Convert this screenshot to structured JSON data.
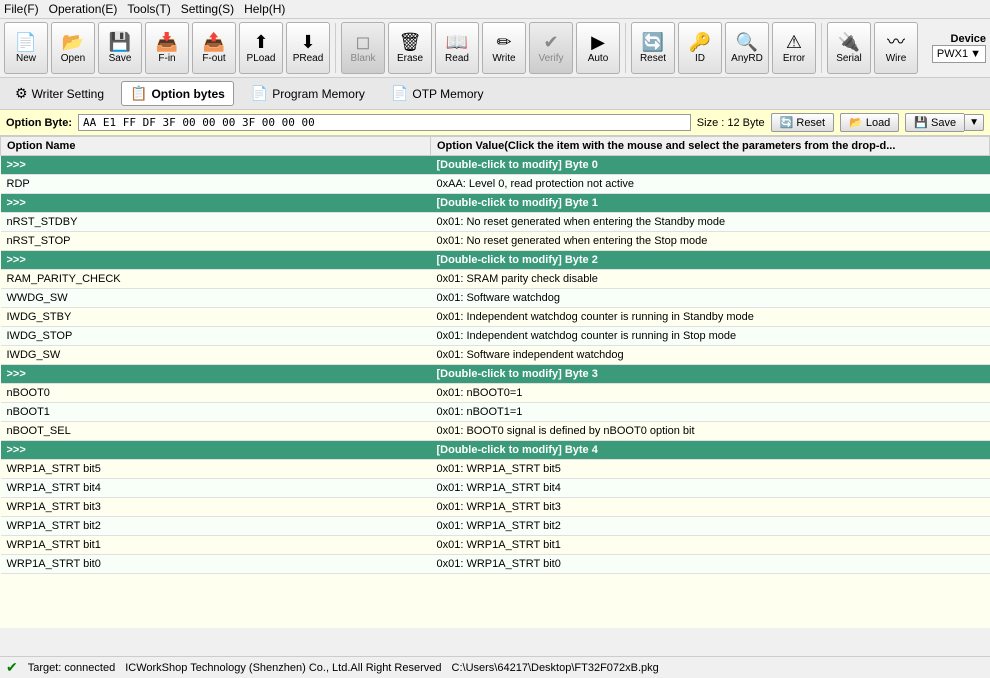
{
  "menubar": {
    "items": [
      {
        "label": "File(F)",
        "name": "menu-file"
      },
      {
        "label": "Operation(E)",
        "name": "menu-operation"
      },
      {
        "label": "Tools(T)",
        "name": "menu-tools"
      },
      {
        "label": "Setting(S)",
        "name": "menu-setting"
      },
      {
        "label": "Help(H)",
        "name": "menu-help"
      }
    ]
  },
  "toolbar": {
    "buttons": [
      {
        "label": "New",
        "icon": "📄",
        "name": "new-button"
      },
      {
        "label": "Open",
        "icon": "📂",
        "name": "open-button"
      },
      {
        "label": "Save",
        "icon": "💾",
        "name": "save-button"
      },
      {
        "label": "F-in",
        "icon": "📥",
        "name": "fin-button"
      },
      {
        "label": "F-out",
        "icon": "📤",
        "name": "fout-button"
      },
      {
        "label": "PLoad",
        "icon": "⬆",
        "name": "pload-button"
      },
      {
        "label": "PRead",
        "icon": "⬇",
        "name": "pread-button"
      },
      {
        "label": "Blank",
        "icon": "◻",
        "name": "blank-button",
        "separator_before": true
      },
      {
        "label": "Erase",
        "icon": "🗑",
        "name": "erase-button"
      },
      {
        "label": "Read",
        "icon": "📖",
        "name": "read-button"
      },
      {
        "label": "Write",
        "icon": "✏",
        "name": "write-button"
      },
      {
        "label": "Verify",
        "icon": "✔",
        "name": "verify-button"
      },
      {
        "label": "Auto",
        "icon": "▶",
        "name": "auto-button"
      },
      {
        "label": "Reset",
        "icon": "🔄",
        "name": "reset-button",
        "separator_before": true
      },
      {
        "label": "ID",
        "icon": "🔑",
        "name": "id-button"
      },
      {
        "label": "AnyRD",
        "icon": "🔍",
        "name": "anyrd-button"
      },
      {
        "label": "Error",
        "icon": "⚠",
        "name": "error-button"
      },
      {
        "label": "Serial",
        "icon": "🔌",
        "name": "serial-button",
        "separator_before": true
      },
      {
        "label": "Wire",
        "icon": "〰",
        "name": "wire-button"
      }
    ],
    "device": {
      "label": "Device",
      "value": "PWX1",
      "name": "device-selector"
    }
  },
  "tabbar": {
    "tabs": [
      {
        "label": "Writer Setting",
        "icon": "⚙",
        "name": "tab-writer-setting"
      },
      {
        "label": "Option bytes",
        "icon": "📋",
        "name": "tab-option-bytes",
        "active": true
      },
      {
        "label": "Program Memory",
        "icon": "📄",
        "name": "tab-program-memory"
      },
      {
        "label": "OTP Memory",
        "icon": "📄",
        "name": "tab-otp-memory"
      }
    ]
  },
  "optionbar": {
    "label": "Option Byte:",
    "value": "AA E1 FF DF 3F 00 00 00 3F 00 00 00",
    "size": "Size : 12 Byte",
    "reset_label": "Reset",
    "load_label": "Load",
    "save_label": "Save"
  },
  "table": {
    "columns": [
      "Option Name",
      "Option Value(Click the item with the mouse and select the parameters from the drop-d..."
    ],
    "rows": [
      {
        "type": "header",
        "name": ">>>",
        "value": "[Double-click to modify] Byte 0"
      },
      {
        "type": "data",
        "name": "RDP",
        "value": "0xAA: Level 0, read protection not active"
      },
      {
        "type": "header",
        "name": ">>>",
        "value": "[Double-click to modify] Byte 1"
      },
      {
        "type": "data",
        "name": "nRST_STDBY",
        "value": "0x01: No reset generated when entering the Standby mode"
      },
      {
        "type": "data",
        "name": "nRST_STOP",
        "value": "0x01: No reset generated when entering the Stop mode"
      },
      {
        "type": "header",
        "name": ">>>",
        "value": "[Double-click to modify] Byte 2"
      },
      {
        "type": "data",
        "name": "RAM_PARITY_CHECK",
        "value": "0x01: SRAM parity check disable"
      },
      {
        "type": "data",
        "name": "WWDG_SW",
        "value": "0x01: Software watchdog"
      },
      {
        "type": "data",
        "name": "IWDG_STBY",
        "value": "0x01: Independent watchdog counter is running in Standby mode"
      },
      {
        "type": "data",
        "name": "IWDG_STOP",
        "value": "0x01: Independent watchdog counter is running in Stop mode"
      },
      {
        "type": "data",
        "name": "IWDG_SW",
        "value": "0x01: Software independent watchdog"
      },
      {
        "type": "header",
        "name": ">>>",
        "value": "[Double-click to modify] Byte 3"
      },
      {
        "type": "data",
        "name": "nBOOT0",
        "value": "0x01: nBOOT0=1"
      },
      {
        "type": "data",
        "name": "nBOOT1",
        "value": "0x01: nBOOT1=1"
      },
      {
        "type": "data",
        "name": "nBOOT_SEL",
        "value": "0x01: BOOT0 signal is defined by nBOOT0 option bit"
      },
      {
        "type": "header",
        "name": ">>>",
        "value": "[Double-click to modify] Byte 4"
      },
      {
        "type": "data",
        "name": "WRP1A_STRT bit5",
        "value": "0x01: WRP1A_STRT bit5"
      },
      {
        "type": "data",
        "name": "WRP1A_STRT bit4",
        "value": "0x01: WRP1A_STRT bit4"
      },
      {
        "type": "data",
        "name": "WRP1A_STRT bit3",
        "value": "0x01: WRP1A_STRT bit3"
      },
      {
        "type": "data",
        "name": "WRP1A_STRT bit2",
        "value": "0x01: WRP1A_STRT bit2"
      },
      {
        "type": "data",
        "name": "WRP1A_STRT bit1",
        "value": "0x01: WRP1A_STRT bit1"
      },
      {
        "type": "data",
        "name": "WRP1A_STRT bit0",
        "value": "0x01: WRP1A_STRT bit0"
      }
    ]
  },
  "statusbar": {
    "connection": "Target: connected",
    "company": "ICWorkShop Technology (Shenzhen) Co., Ltd.All Right Reserved",
    "filepath": "C:\\Users\\64217\\Desktop\\FT32F072xB.pkg"
  }
}
